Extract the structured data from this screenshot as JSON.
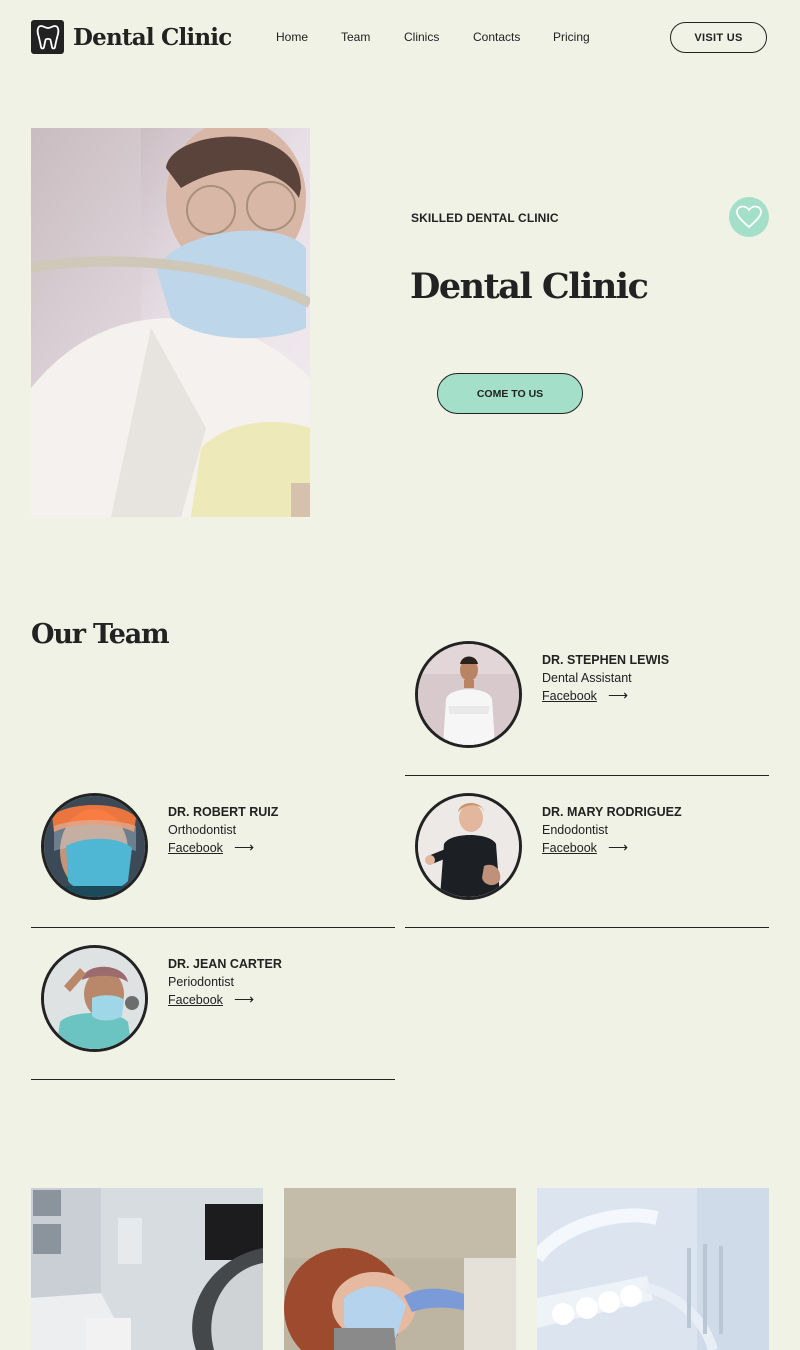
{
  "header": {
    "brand": "Dental Clinic",
    "nav": [
      "Home",
      "Team",
      "Clinics",
      "Contacts",
      "Pricing"
    ],
    "visit_label": "VISIT US"
  },
  "hero": {
    "kicker": "SKILLED DENTAL CLINIC",
    "title": "Dental Clinic",
    "cta_label": "COME TO US"
  },
  "team": {
    "title": "Our Team",
    "members": [
      {
        "name": "DR. STEPHEN LEWIS",
        "role": "Dental Assistant",
        "link": "Facebook"
      },
      {
        "name": "DR. ROBERT RUIZ",
        "role": "Orthodontist",
        "link": "Facebook"
      },
      {
        "name": "DR. MARY RODRIGUEZ",
        "role": "Endodontist",
        "link": "Facebook"
      },
      {
        "name": "DR. JEAN CARTER",
        "role": "Periodontist",
        "link": "Facebook"
      }
    ]
  },
  "icons": {
    "logo": "tooth-icon",
    "badge": "heart-icon",
    "link_arrow": "arrow-right-icon"
  },
  "colors": {
    "background": "#f0f2e6",
    "accent": "#a4dfca",
    "text": "#222222"
  }
}
